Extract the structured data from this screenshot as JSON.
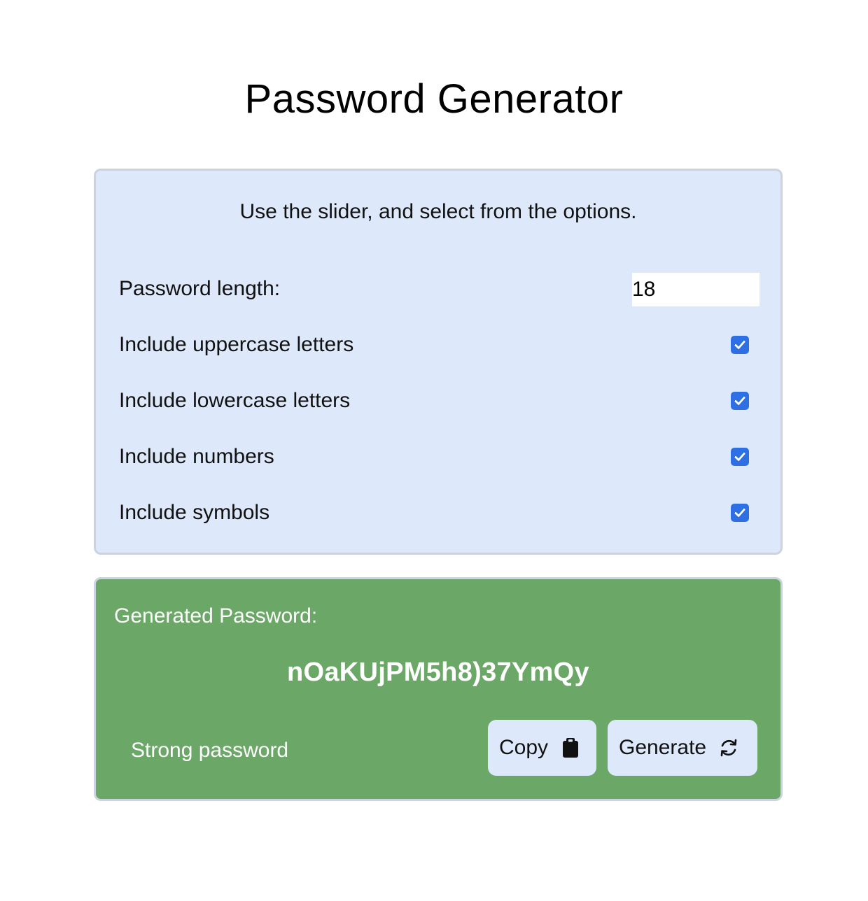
{
  "page": {
    "title": "Password Generator"
  },
  "options": {
    "instructions": "Use the slider, and select from the options.",
    "length": {
      "label": "Password length:",
      "value": "18"
    },
    "toggles": [
      {
        "label": "Include uppercase letters",
        "checked": true
      },
      {
        "label": "Include lowercase letters",
        "checked": true
      },
      {
        "label": "Include numbers",
        "checked": true
      },
      {
        "label": "Include symbols",
        "checked": true
      }
    ]
  },
  "result": {
    "label": "Generated Password:",
    "password": "nOaKUjPM5h8)37YmQy",
    "strength": "Strong password",
    "copy_label": "Copy",
    "copy_icon": "clipboard-icon",
    "generate_label": "Generate",
    "generate_icon": "refresh-icon"
  },
  "colors": {
    "options_bg": "#dde8fa",
    "result_bg": "#6ba766",
    "checkbox": "#2f6fe4",
    "border": "#cdd3de"
  }
}
